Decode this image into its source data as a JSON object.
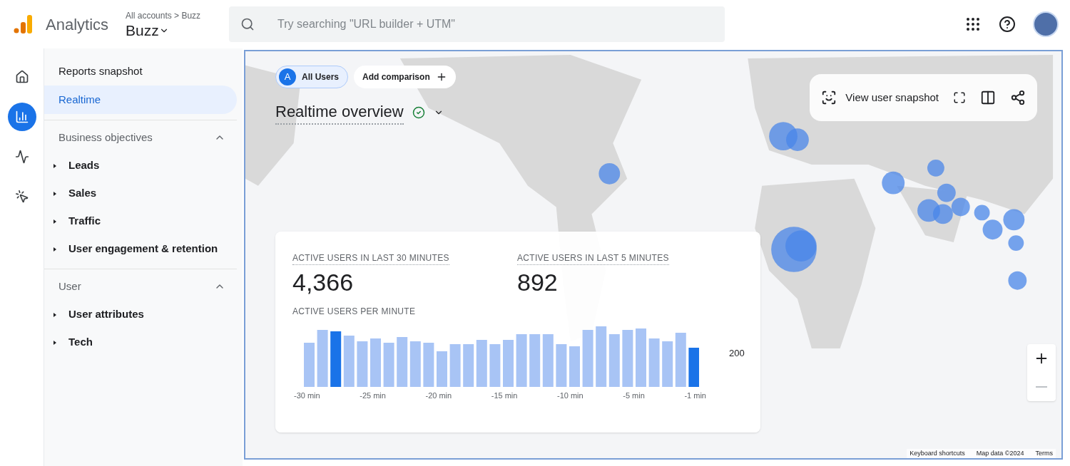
{
  "header": {
    "product": "Analytics",
    "breadcrumb": "All accounts > Buzz",
    "property": "Buzz",
    "search": {
      "placeholder": "Try searching \"URL builder + UTM\""
    }
  },
  "rail": [
    {
      "kind": "home",
      "selected": false
    },
    {
      "kind": "reports",
      "selected": true
    },
    {
      "kind": "explore",
      "selected": false
    },
    {
      "kind": "advertising",
      "selected": false
    }
  ],
  "sidebar": {
    "items": [
      {
        "label": "Reports snapshot",
        "selected": false
      },
      {
        "label": "Realtime",
        "selected": true
      }
    ],
    "sections": [
      {
        "title": "Business objectives",
        "expanded": true,
        "children": [
          {
            "label": "Leads",
            "expanded": false
          },
          {
            "label": "Sales",
            "expanded": false
          },
          {
            "label": "Traffic",
            "expanded": false
          },
          {
            "label": "User engagement & retention",
            "expanded": false
          }
        ]
      },
      {
        "title": "User",
        "expanded": true,
        "children": [
          {
            "label": "User attributes",
            "expanded": false
          },
          {
            "label": "Tech",
            "expanded": false
          }
        ]
      }
    ]
  },
  "main": {
    "comparison": {
      "badge": "A",
      "label": "All Users"
    },
    "add_comparison": "Add comparison",
    "title": "Realtime overview",
    "toolbar": {
      "snapshot": "View user snapshot"
    },
    "stats": [
      {
        "label": "ACTIVE USERS IN LAST 30 MINUTES",
        "value": "4,366"
      },
      {
        "label": "ACTIVE USERS IN LAST 5 MINUTES",
        "value": "892"
      }
    ],
    "chart": {
      "title": "ACTIVE USERS PER MINUTE",
      "y_label": "200",
      "x_labels": [
        "-30 min",
        "-25 min",
        "-20 min",
        "-15 min",
        "-10 min",
        "-5 min",
        "-1 min"
      ]
    },
    "map_footer": [
      "Keyboard shortcuts",
      "Map data ©2024",
      "Terms"
    ]
  }
}
